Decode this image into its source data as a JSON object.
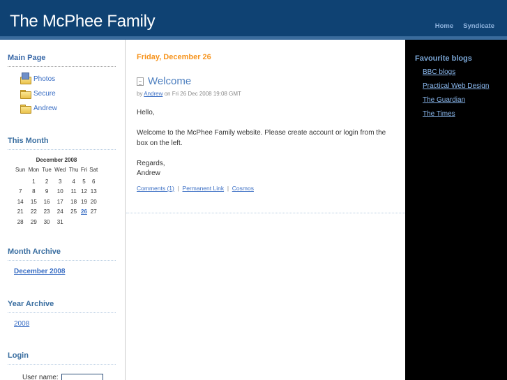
{
  "header": {
    "site_title": "The McPhee Family",
    "nav": [
      {
        "label": "Home"
      },
      {
        "label": "Syndicate"
      }
    ],
    "colors": {
      "background": "#0f4273",
      "band": "#3a6b9c",
      "nav_link": "#8fb3dd"
    }
  },
  "left_sidebar": {
    "main_page": {
      "heading": "Main Page",
      "items": [
        {
          "label": "Photos",
          "icon": "photo-folder-icon"
        },
        {
          "label": "Secure",
          "icon": "folder-icon"
        },
        {
          "label": "Andrew",
          "icon": "folder-icon"
        }
      ]
    },
    "this_month": {
      "heading": "This Month",
      "calendar": {
        "caption": "December 2008",
        "weekdays": [
          "Sun",
          "Mon",
          "Tue",
          "Wed",
          "Thu",
          "Fri",
          "Sat"
        ],
        "weeks": [
          [
            "",
            "1",
            "2",
            "3",
            "4",
            "5",
            "6"
          ],
          [
            "7",
            "8",
            "9",
            "10",
            "11",
            "12",
            "13"
          ],
          [
            "14",
            "15",
            "16",
            "17",
            "18",
            "19",
            "20"
          ],
          [
            "21",
            "22",
            "23",
            "24",
            "25",
            "26",
            "27"
          ],
          [
            "28",
            "29",
            "30",
            "31",
            "",
            "",
            ""
          ]
        ],
        "linked_day": "26"
      }
    },
    "month_archive": {
      "heading": "Month Archive",
      "link": "December 2008"
    },
    "year_archive": {
      "heading": "Year Archive",
      "link": "2008"
    },
    "login": {
      "heading": "Login",
      "username_label": "User name:",
      "username_value": ""
    }
  },
  "main": {
    "date_heading": "Friday, December 26",
    "post": {
      "title": "Welcome",
      "byline_prefix": "by",
      "author": "Andrew",
      "byline_suffix": "on Fri 26 Dec 2008 19:08 GMT",
      "paragraphs": [
        "Hello,",
        "Welcome to the McPhee Family website. Please create account or login from the box on the left.",
        "Regards,\nAndrew"
      ],
      "links": [
        {
          "label": "Comments (1)"
        },
        {
          "label": "Permanent Link"
        },
        {
          "label": "Cosmos"
        }
      ],
      "link_separator": "|"
    },
    "colors": {
      "date_heading": "#f7941d",
      "post_title": "#4d7fbf",
      "link": "#3a6ec4"
    }
  },
  "right_sidebar": {
    "heading": "Favourite blogs",
    "links": [
      {
        "label": "BBC blogs"
      },
      {
        "label": "Practical Web Design"
      },
      {
        "label": "The Guardian"
      },
      {
        "label": "The Times"
      }
    ],
    "colors": {
      "background": "#000000",
      "heading": "#7aa6d6",
      "link": "#8ab8ee"
    }
  }
}
